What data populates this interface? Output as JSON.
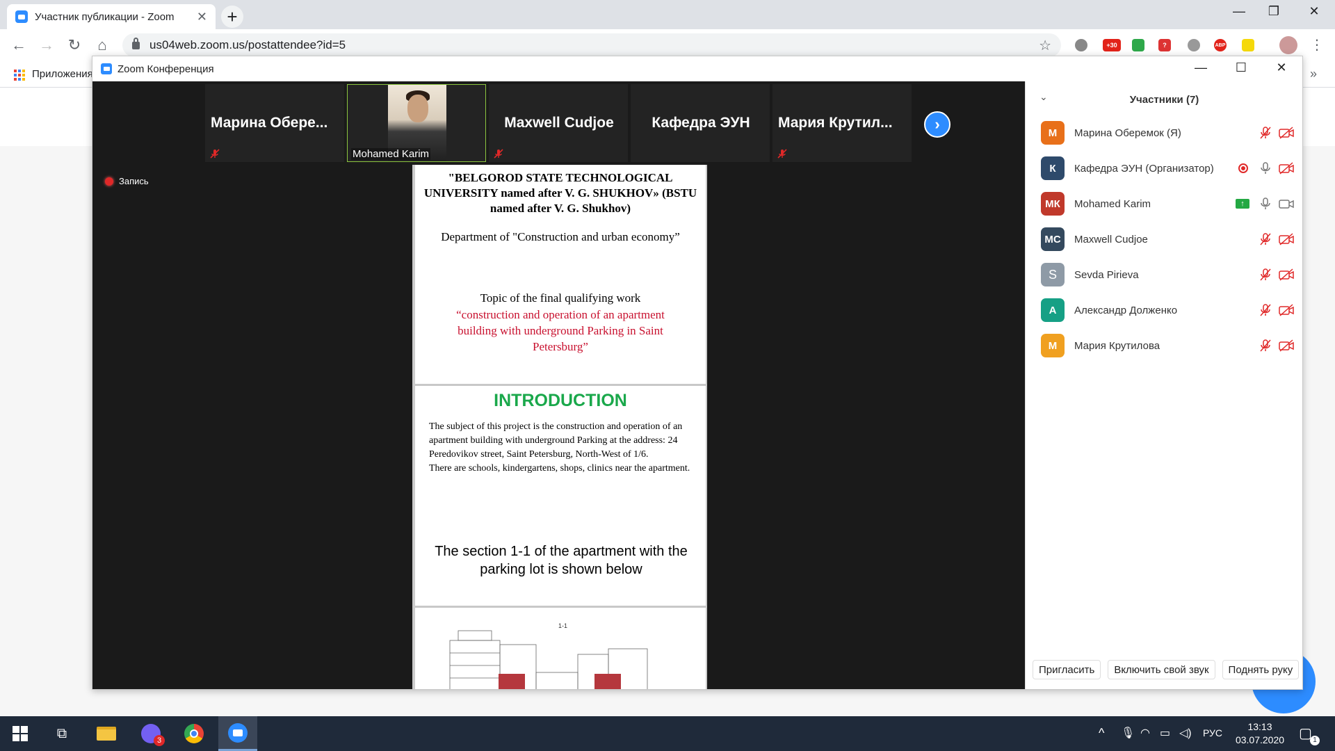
{
  "browser": {
    "tab_title": "Участник публикации - Zoom",
    "tab_close": "✕",
    "new_tab": "+",
    "minimize": "—",
    "maximize": "❐",
    "close": "✕",
    "url": "us04web.zoom.us/postattendee?id=5",
    "bookmark_label": "Приложения",
    "bookmark_more": "»",
    "ext_badge_1": "+30",
    "ext_badge_abp": "ABP",
    "ext_badge_q": "?"
  },
  "zoom": {
    "window_title": "Zoom Конференция",
    "recording_label": "Запись",
    "thumbnails": [
      {
        "name": "Марина  Обере..."
      },
      {
        "name": "Mohamed Karim"
      },
      {
        "name": "Maxwell Cudjoe"
      },
      {
        "name": "Кафедра ЭУН"
      },
      {
        "name": "Мария  Крутил..."
      }
    ],
    "next_arrow": "›"
  },
  "document": {
    "slide1": {
      "university": "\"BELGOROD STATE TECHNOLOGICAL UNIVERSITY named after V. G. SHUKHOV» (BSTU named after V. G. Shukhov)",
      "department": "Department of \"Construction and urban economy”",
      "topic_label": "Topic of the final qualifying work",
      "topic_text": "“construction and operation of an apartment building with underground Parking  in Saint Petersburg”"
    },
    "slide2": {
      "title": "INTRODUCTION",
      "body_1": "The subject of this project is the construction and operation of an apartment building with underground Parking at the address: 24 Peredovikov street, Saint Petersburg, North-West of 1/6.",
      "body_2": "There are schools, kindergartens, shops, clinics near the apartment.",
      "section_text": "The  section 1-1 of the apartment with the parking lot  is shown below"
    },
    "slide3": {
      "drawing_label": "1-1"
    }
  },
  "participants_panel": {
    "title": "Участники (7)",
    "collapse": "⌄",
    "participants": [
      {
        "initials": "М",
        "name": "Марина Оберемок (Я)",
        "color": "#e8701a"
      },
      {
        "initials": "К",
        "name": "Кафедра ЭУН (Организатор)",
        "color": "#2e4a6b"
      },
      {
        "initials": "МК",
        "name": "Mohamed Karim",
        "color": "#c0392b"
      },
      {
        "initials": "MC",
        "name": "Maxwell Cudjoe",
        "color": "#34495e"
      },
      {
        "initials": "S",
        "name": "Sevda Pirieva",
        "color": "#8e9aa6"
      },
      {
        "initials": "А",
        "name": "Александр Долженко",
        "color": "#16a085"
      },
      {
        "initials": "М",
        "name": "Мария Крутилова",
        "color": "#f0a020"
      }
    ],
    "buttons": {
      "invite": "Пригласить",
      "unmute": "Включить свой звук",
      "raise_hand": "Поднять руку"
    }
  },
  "taskbar": {
    "viber_badge": "3",
    "lang": "РУС",
    "time": "13:13",
    "date": "03.07.2020",
    "notif_count": "1"
  }
}
